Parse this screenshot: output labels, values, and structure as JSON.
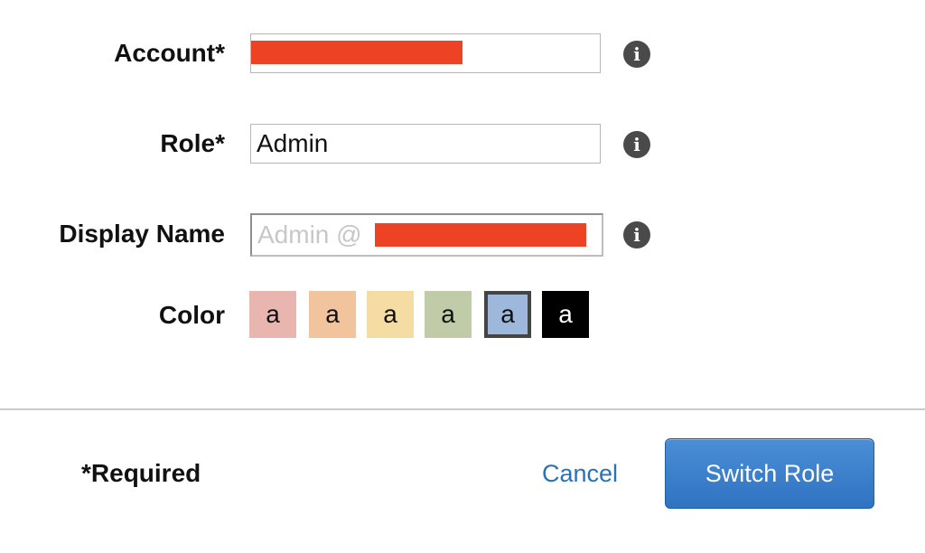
{
  "form": {
    "account": {
      "label": "Account*",
      "value": ""
    },
    "role": {
      "label": "Role*",
      "value": "Admin"
    },
    "display_name": {
      "label": "Display Name",
      "placeholder": "Admin @"
    },
    "color": {
      "label": "Color",
      "swatches": [
        {
          "text": "a",
          "color": "#e8b6ae",
          "text_color": "#111111"
        },
        {
          "text": "a",
          "color": "#f2c49e",
          "text_color": "#111111"
        },
        {
          "text": "a",
          "color": "#f5dca2",
          "text_color": "#111111"
        },
        {
          "text": "a",
          "color": "#bfcca7",
          "text_color": "#111111"
        },
        {
          "text": "a",
          "color": "#9db8da",
          "text_color": "#111111",
          "selected": true
        },
        {
          "text": "a",
          "color": "#000000",
          "text_color": "#ffffff"
        }
      ]
    },
    "info_icon": "i",
    "redaction_color": "#ee4224"
  },
  "footer": {
    "required_note": "*Required",
    "cancel_label": "Cancel",
    "submit_label": "Switch Role"
  }
}
